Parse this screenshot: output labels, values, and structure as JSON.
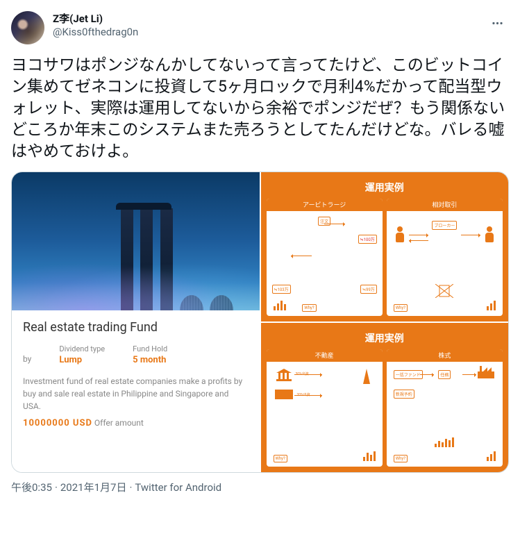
{
  "user": {
    "display_name": "Z李(Jet Li)",
    "handle": "@Kiss0fthedrag0n"
  },
  "tweet_text": "ヨコサワはポンジなんかしてないって言ってたけど、このビットコイン集めてゼネコンに投資して5ヶ月ロックで月利4%だかって配当型ウォレット、実際は運用してないから余裕でポンジだぜ？もう関係ないどころか年末このシステムまた売ろうとしてたんだけどな。バレる嘘はやめておけよ。",
  "card": {
    "title": "Real estate trading Fund",
    "by": "by",
    "dividend_label": "Dividend type",
    "dividend_value": "Lump",
    "hold_label": "Fund Hold",
    "hold_value": "5 month",
    "description": "Investment fund of real estate companies make a profits by buy and sale real estate in Philippine and Singapore and USA.",
    "offer_amount": "10000000 USD",
    "offer_label": "Offer amount"
  },
  "orange": {
    "header": "運用実例",
    "box1": "アービトラージ",
    "box2": "相対取引",
    "box3": "不動産",
    "box4": "株式",
    "broker": "ブローカー",
    "v1": "≒100万",
    "v2": "≒103万",
    "v3": "≒99万",
    "p20": "20%出資",
    "p30": "30%出資",
    "why": "Why?"
  },
  "meta": {
    "time": "午後0:35",
    "date": "2021年1月7日",
    "source": "Twitter for Android"
  }
}
